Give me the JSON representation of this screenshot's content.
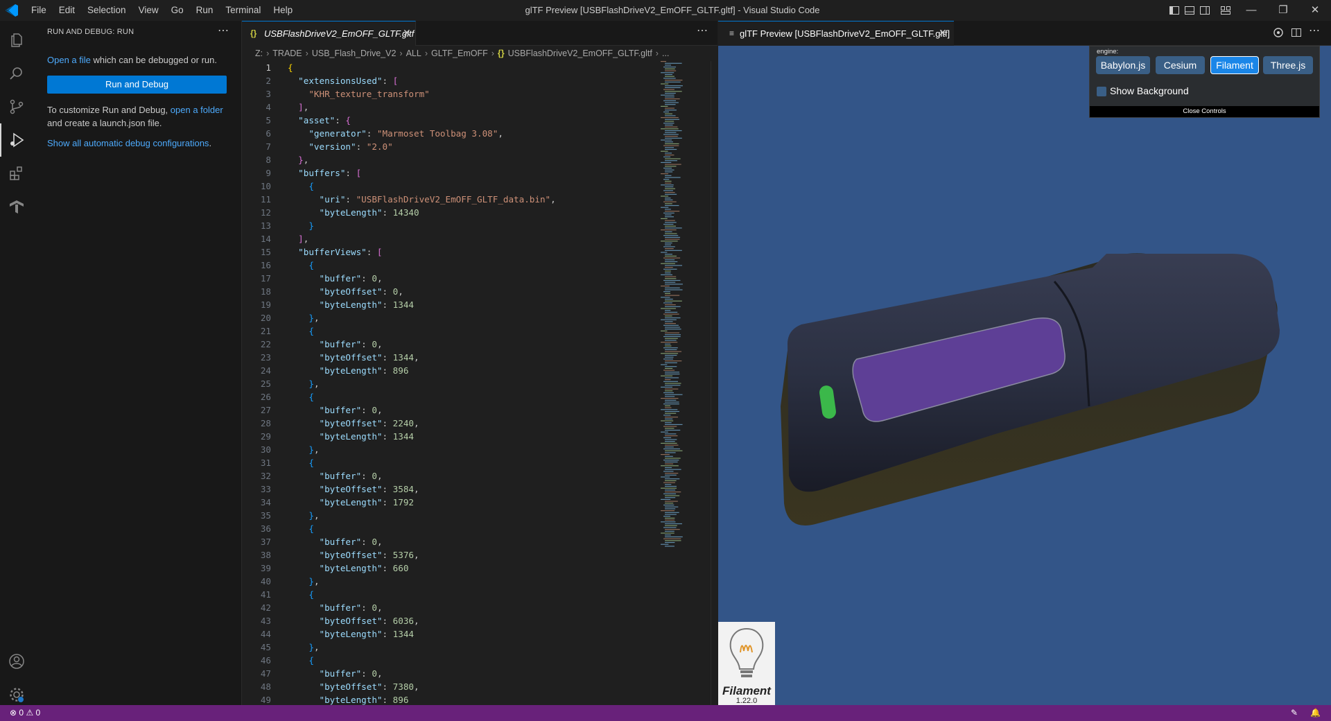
{
  "window": {
    "title": "glTF Preview [USBFlashDriveV2_EmOFF_GLTF.gltf] - Visual Studio Code",
    "menu": [
      "File",
      "Edit",
      "Selection",
      "View",
      "Go",
      "Run",
      "Terminal",
      "Help"
    ]
  },
  "sidebar": {
    "title": "RUN AND DEBUG: RUN",
    "open_file_link": "Open a file",
    "open_file_rest": " which can be debugged or run.",
    "run_button": "Run and Debug",
    "customize_text": "To customize Run and Debug, ",
    "open_folder_link": "open a folder",
    "customize_rest": "and create a launch.json file.",
    "show_all_link": "Show all automatic debug configurations",
    "show_all_period": "."
  },
  "editor": {
    "tab_label": "USBFlashDriveV2_EmOFF_GLTF.gltf",
    "breadcrumb": [
      "Z:",
      "TRADE",
      "USB_Flash_Drive_V2",
      "ALL",
      "GLTF_EmOFF",
      "USBFlashDriveV2_EmOFF_GLTF.gltf",
      "..."
    ],
    "lines": [
      {
        "n": "1",
        "t": [
          [
            "b1",
            "{"
          ]
        ]
      },
      {
        "n": "2",
        "t": [
          [
            "",
            "  "
          ],
          [
            "key",
            "\"extensionsUsed\""
          ],
          [
            "",
            ": "
          ],
          [
            "b2",
            "["
          ]
        ]
      },
      {
        "n": "3",
        "t": [
          [
            "",
            "    "
          ],
          [
            "str",
            "\"KHR_texture_transform\""
          ]
        ]
      },
      {
        "n": "4",
        "t": [
          [
            "",
            "  "
          ],
          [
            "b2",
            "]"
          ],
          [
            "",
            ","
          ]
        ]
      },
      {
        "n": "5",
        "t": [
          [
            "",
            "  "
          ],
          [
            "key",
            "\"asset\""
          ],
          [
            "",
            ": "
          ],
          [
            "b2",
            "{"
          ]
        ]
      },
      {
        "n": "6",
        "t": [
          [
            "",
            "    "
          ],
          [
            "key",
            "\"generator\""
          ],
          [
            "",
            ": "
          ],
          [
            "str",
            "\"Marmoset Toolbag 3.08\""
          ],
          [
            "",
            ","
          ]
        ]
      },
      {
        "n": "7",
        "t": [
          [
            "",
            "    "
          ],
          [
            "key",
            "\"version\""
          ],
          [
            "",
            ": "
          ],
          [
            "str",
            "\"2.0\""
          ]
        ]
      },
      {
        "n": "8",
        "t": [
          [
            "",
            "  "
          ],
          [
            "b2",
            "}"
          ],
          [
            "",
            ","
          ]
        ]
      },
      {
        "n": "9",
        "t": [
          [
            "",
            "  "
          ],
          [
            "key",
            "\"buffers\""
          ],
          [
            "",
            ": "
          ],
          [
            "b2",
            "["
          ]
        ]
      },
      {
        "n": "10",
        "t": [
          [
            "",
            "    "
          ],
          [
            "b3",
            "{"
          ]
        ]
      },
      {
        "n": "11",
        "t": [
          [
            "",
            "      "
          ],
          [
            "key",
            "\"uri\""
          ],
          [
            "",
            ": "
          ],
          [
            "str",
            "\"USBFlashDriveV2_EmOFF_GLTF_data.bin\""
          ],
          [
            "",
            ","
          ]
        ]
      },
      {
        "n": "12",
        "t": [
          [
            "",
            "      "
          ],
          [
            "key",
            "\"byteLength\""
          ],
          [
            "",
            ": "
          ],
          [
            "num",
            "14340"
          ]
        ]
      },
      {
        "n": "13",
        "t": [
          [
            "",
            "    "
          ],
          [
            "b3",
            "}"
          ]
        ]
      },
      {
        "n": "14",
        "t": [
          [
            "",
            "  "
          ],
          [
            "b2",
            "]"
          ],
          [
            "",
            ","
          ]
        ]
      },
      {
        "n": "15",
        "t": [
          [
            "",
            "  "
          ],
          [
            "key",
            "\"bufferViews\""
          ],
          [
            "",
            ": "
          ],
          [
            "b2",
            "["
          ]
        ]
      },
      {
        "n": "16",
        "t": [
          [
            "",
            "    "
          ],
          [
            "b3",
            "{"
          ]
        ]
      },
      {
        "n": "17",
        "t": [
          [
            "",
            "      "
          ],
          [
            "key",
            "\"buffer\""
          ],
          [
            "",
            ": "
          ],
          [
            "num",
            "0"
          ],
          [
            "",
            ","
          ]
        ]
      },
      {
        "n": "18",
        "t": [
          [
            "",
            "      "
          ],
          [
            "key",
            "\"byteOffset\""
          ],
          [
            "",
            ": "
          ],
          [
            "num",
            "0"
          ],
          [
            "",
            ","
          ]
        ]
      },
      {
        "n": "19",
        "t": [
          [
            "",
            "      "
          ],
          [
            "key",
            "\"byteLength\""
          ],
          [
            "",
            ": "
          ],
          [
            "num",
            "1344"
          ]
        ]
      },
      {
        "n": "20",
        "t": [
          [
            "",
            "    "
          ],
          [
            "b3",
            "}"
          ],
          [
            "",
            ","
          ]
        ]
      },
      {
        "n": "21",
        "t": [
          [
            "",
            "    "
          ],
          [
            "b3",
            "{"
          ]
        ]
      },
      {
        "n": "22",
        "t": [
          [
            "",
            "      "
          ],
          [
            "key",
            "\"buffer\""
          ],
          [
            "",
            ": "
          ],
          [
            "num",
            "0"
          ],
          [
            "",
            ","
          ]
        ]
      },
      {
        "n": "23",
        "t": [
          [
            "",
            "      "
          ],
          [
            "key",
            "\"byteOffset\""
          ],
          [
            "",
            ": "
          ],
          [
            "num",
            "1344"
          ],
          [
            "",
            ","
          ]
        ]
      },
      {
        "n": "24",
        "t": [
          [
            "",
            "      "
          ],
          [
            "key",
            "\"byteLength\""
          ],
          [
            "",
            ": "
          ],
          [
            "num",
            "896"
          ]
        ]
      },
      {
        "n": "25",
        "t": [
          [
            "",
            "    "
          ],
          [
            "b3",
            "}"
          ],
          [
            "",
            ","
          ]
        ]
      },
      {
        "n": "26",
        "t": [
          [
            "",
            "    "
          ],
          [
            "b3",
            "{"
          ]
        ]
      },
      {
        "n": "27",
        "t": [
          [
            "",
            "      "
          ],
          [
            "key",
            "\"buffer\""
          ],
          [
            "",
            ": "
          ],
          [
            "num",
            "0"
          ],
          [
            "",
            ","
          ]
        ]
      },
      {
        "n": "28",
        "t": [
          [
            "",
            "      "
          ],
          [
            "key",
            "\"byteOffset\""
          ],
          [
            "",
            ": "
          ],
          [
            "num",
            "2240"
          ],
          [
            "",
            ","
          ]
        ]
      },
      {
        "n": "29",
        "t": [
          [
            "",
            "      "
          ],
          [
            "key",
            "\"byteLength\""
          ],
          [
            "",
            ": "
          ],
          [
            "num",
            "1344"
          ]
        ]
      },
      {
        "n": "30",
        "t": [
          [
            "",
            "    "
          ],
          [
            "b3",
            "}"
          ],
          [
            "",
            ","
          ]
        ]
      },
      {
        "n": "31",
        "t": [
          [
            "",
            "    "
          ],
          [
            "b3",
            "{"
          ]
        ]
      },
      {
        "n": "32",
        "t": [
          [
            "",
            "      "
          ],
          [
            "key",
            "\"buffer\""
          ],
          [
            "",
            ": "
          ],
          [
            "num",
            "0"
          ],
          [
            "",
            ","
          ]
        ]
      },
      {
        "n": "33",
        "t": [
          [
            "",
            "      "
          ],
          [
            "key",
            "\"byteOffset\""
          ],
          [
            "",
            ": "
          ],
          [
            "num",
            "3584"
          ],
          [
            "",
            ","
          ]
        ]
      },
      {
        "n": "34",
        "t": [
          [
            "",
            "      "
          ],
          [
            "key",
            "\"byteLength\""
          ],
          [
            "",
            ": "
          ],
          [
            "num",
            "1792"
          ]
        ]
      },
      {
        "n": "35",
        "t": [
          [
            "",
            "    "
          ],
          [
            "b3",
            "}"
          ],
          [
            "",
            ","
          ]
        ]
      },
      {
        "n": "36",
        "t": [
          [
            "",
            "    "
          ],
          [
            "b3",
            "{"
          ]
        ]
      },
      {
        "n": "37",
        "t": [
          [
            "",
            "      "
          ],
          [
            "key",
            "\"buffer\""
          ],
          [
            "",
            ": "
          ],
          [
            "num",
            "0"
          ],
          [
            "",
            ","
          ]
        ]
      },
      {
        "n": "38",
        "t": [
          [
            "",
            "      "
          ],
          [
            "key",
            "\"byteOffset\""
          ],
          [
            "",
            ": "
          ],
          [
            "num",
            "5376"
          ],
          [
            "",
            ","
          ]
        ]
      },
      {
        "n": "39",
        "t": [
          [
            "",
            "      "
          ],
          [
            "key",
            "\"byteLength\""
          ],
          [
            "",
            ": "
          ],
          [
            "num",
            "660"
          ]
        ]
      },
      {
        "n": "40",
        "t": [
          [
            "",
            "    "
          ],
          [
            "b3",
            "}"
          ],
          [
            "",
            ","
          ]
        ]
      },
      {
        "n": "41",
        "t": [
          [
            "",
            "    "
          ],
          [
            "b3",
            "{"
          ]
        ]
      },
      {
        "n": "42",
        "t": [
          [
            "",
            "      "
          ],
          [
            "key",
            "\"buffer\""
          ],
          [
            "",
            ": "
          ],
          [
            "num",
            "0"
          ],
          [
            "",
            ","
          ]
        ]
      },
      {
        "n": "43",
        "t": [
          [
            "",
            "      "
          ],
          [
            "key",
            "\"byteOffset\""
          ],
          [
            "",
            ": "
          ],
          [
            "num",
            "6036"
          ],
          [
            "",
            ","
          ]
        ]
      },
      {
        "n": "44",
        "t": [
          [
            "",
            "      "
          ],
          [
            "key",
            "\"byteLength\""
          ],
          [
            "",
            ": "
          ],
          [
            "num",
            "1344"
          ]
        ]
      },
      {
        "n": "45",
        "t": [
          [
            "",
            "    "
          ],
          [
            "b3",
            "}"
          ],
          [
            "",
            ","
          ]
        ]
      },
      {
        "n": "46",
        "t": [
          [
            "",
            "    "
          ],
          [
            "b3",
            "{"
          ]
        ]
      },
      {
        "n": "47",
        "t": [
          [
            "",
            "      "
          ],
          [
            "key",
            "\"buffer\""
          ],
          [
            "",
            ": "
          ],
          [
            "num",
            "0"
          ],
          [
            "",
            ","
          ]
        ]
      },
      {
        "n": "48",
        "t": [
          [
            "",
            "      "
          ],
          [
            "key",
            "\"byteOffset\""
          ],
          [
            "",
            ": "
          ],
          [
            "num",
            "7380"
          ],
          [
            "",
            ","
          ]
        ]
      },
      {
        "n": "49",
        "t": [
          [
            "",
            "      "
          ],
          [
            "key",
            "\"byteLength\""
          ],
          [
            "",
            ": "
          ],
          [
            "num",
            "896"
          ]
        ]
      }
    ]
  },
  "preview": {
    "tab_label": "glTF Preview [USBFlashDriveV2_EmOFF_GLTF.gltf]",
    "engine_label": "engine:",
    "engines": [
      "Babylon.js",
      "Cesium",
      "Filament",
      "Three.js"
    ],
    "selected_engine": "Filament",
    "show_background_label": "Show Background",
    "show_background_checked": false,
    "close_controls": "Close Controls",
    "logo_name": "Filament",
    "logo_version": "1.22.0"
  },
  "statusbar": {
    "errors": "0",
    "warnings": "0",
    "color": "#68217a"
  },
  "colors": {
    "accent": "#0078d4",
    "viewport_bg": "#335588"
  }
}
